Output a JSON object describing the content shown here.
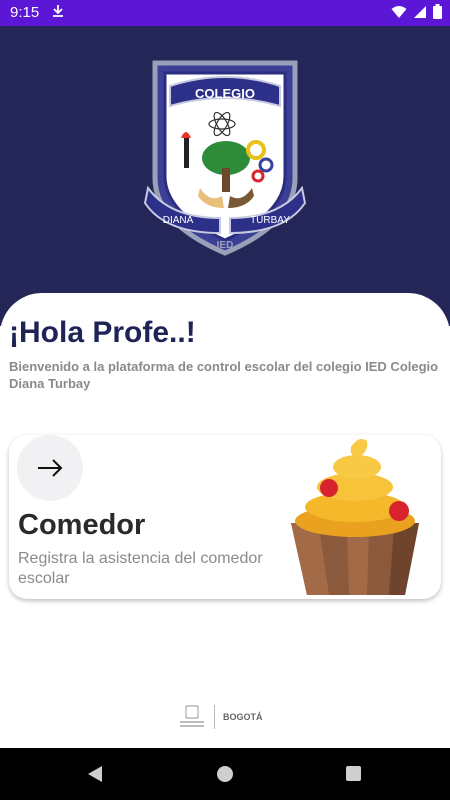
{
  "status": {
    "time": "9:15"
  },
  "crest": {
    "top_text": "COLEGIO",
    "left_text": "DIANA",
    "right_text": "TURBAY",
    "bottom_text": "IED"
  },
  "greeting": {
    "title": "¡Hola Profe..!",
    "subtitle": "Bienvenido a la plataforma de control escolar del colegio IED Colegio Diana Turbay"
  },
  "card": {
    "title": "Comedor",
    "description": "Registra la asistencia del comedor escolar",
    "arrow_icon": "arrow-right-icon",
    "image_icon": "cupcake-icon"
  },
  "footer": {
    "logo_text": "BOGOTÁ"
  },
  "colors": {
    "status_bar": "#5b16d6",
    "header": "#252658",
    "title": "#1f2457"
  }
}
